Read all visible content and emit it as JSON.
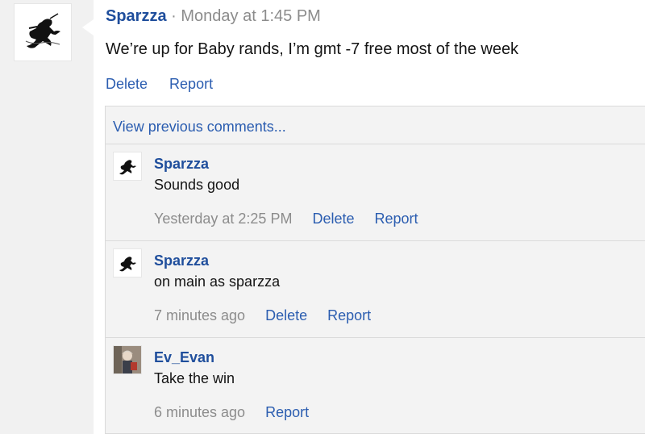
{
  "post": {
    "author": "Sparzza",
    "separator": "·",
    "timestamp": "Monday at 1:45 PM",
    "body": "We’re up for Baby rands, I’m gmt -7 free most of the week",
    "delete_label": "Delete",
    "report_label": "Report",
    "avatar_icon": "ninja-silhouette-icon"
  },
  "comments_section": {
    "view_previous": "View previous comments..."
  },
  "comments": [
    {
      "author": "Sparzza",
      "text": "Sounds good",
      "time": "Yesterday at 2:25 PM",
      "delete_label": "Delete",
      "report_label": "Report",
      "avatar_icon": "ninja-silhouette-icon"
    },
    {
      "author": "Sparzza",
      "text": "on main as sparzza",
      "time": "7 minutes ago",
      "delete_label": "Delete",
      "report_label": "Report",
      "avatar_icon": "ninja-silhouette-icon"
    },
    {
      "author": "Ev_Evan",
      "text": "Take the win",
      "time": "6 minutes ago",
      "report_label": "Report",
      "avatar_icon": "anime-character-icon"
    }
  ],
  "colors": {
    "link": "#2b5db0",
    "username": "#1f4e9c",
    "muted": "#8c8c8c",
    "panel_bg": "#ffffff",
    "comment_bg": "#f3f3f3"
  }
}
